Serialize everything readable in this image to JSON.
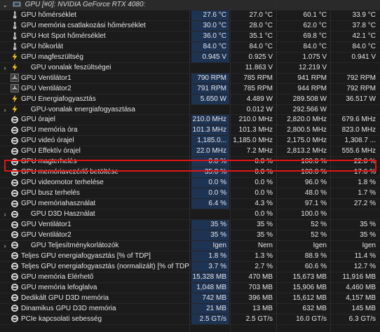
{
  "header": {
    "title": "GPU [#0]: NVIDIA GeForce RTX 4080:"
  },
  "rows": [
    {
      "icon": "thermometer-icon",
      "name": "GPU hőmérséklet",
      "v": [
        "27.6 °C",
        "27.0 °C",
        "60.1 °C",
        "33.9 °C"
      ]
    },
    {
      "icon": "thermometer-icon",
      "name": "GPU memória csatlakozási hőmérséklet",
      "v": [
        "30.0 °C",
        "28.0 °C",
        "62.0 °C",
        "37.8 °C"
      ]
    },
    {
      "icon": "thermometer-icon",
      "name": "GPU Hot Spot hőmérséklet",
      "v": [
        "36.0 °C",
        "35.1 °C",
        "69.8 °C",
        "42.1 °C"
      ]
    },
    {
      "icon": "thermometer-icon",
      "name": "GPU hőkorlát",
      "v": [
        "84.0 °C",
        "84.0 °C",
        "84.0 °C",
        "84.0 °C"
      ]
    },
    {
      "icon": "lightning-icon",
      "name": "GPU magfeszültség",
      "v": [
        "0.945 V",
        "0.925 V",
        "1.075 V",
        "0.941 V"
      ]
    },
    {
      "icon": "lightning-icon",
      "sub": true,
      "name": "GPU vonalak feszültségei",
      "v": [
        "",
        "11.863 V",
        "12.219 V",
        ""
      ]
    },
    {
      "icon": "fan-icon",
      "name": "GPU Ventilátor1",
      "v": [
        "790 RPM",
        "785 RPM",
        "941 RPM",
        "792 RPM"
      ]
    },
    {
      "icon": "fan-icon",
      "name": "GPU Ventilátor2",
      "v": [
        "791 RPM",
        "785 RPM",
        "944 RPM",
        "792 RPM"
      ]
    },
    {
      "icon": "lightning-icon",
      "name": "GPU Energiafogyasztás",
      "v": [
        "5.650 W",
        "4.489 W",
        "289.508 W",
        "36.517 W"
      ]
    },
    {
      "icon": "lightning-icon",
      "sub": true,
      "name": "GPU-vonalak energiafogyasztása",
      "v": [
        "",
        "0.012 W",
        "292.566 W",
        ""
      ]
    },
    {
      "icon": "gauge-icon",
      "name": "GPU órajel",
      "v": [
        "210.0 MHz",
        "210.0 MHz",
        "2,820.0 MHz",
        "679.6 MHz"
      ]
    },
    {
      "icon": "gauge-icon",
      "name": "GPU memória óra",
      "v": [
        "101.3 MHz",
        "101.3 MHz",
        "2,800.5 MHz",
        "823.0 MHz"
      ]
    },
    {
      "icon": "gauge-icon",
      "name": "GPU videó órajel",
      "v": [
        "1,185.0...",
        "1,185.0 MHz",
        "2,175.0 MHz",
        "1,308.7 ..."
      ]
    },
    {
      "icon": "gauge-icon",
      "name": "GPU Effektív órajel",
      "v": [
        "22.0 MHz",
        "7.2 MHz",
        "2,813.2 MHz",
        "555.6 MHz"
      ]
    },
    {
      "icon": "gauge-icon",
      "name": "GPU magterhelés",
      "v": [
        "0.0 %",
        "0.0 %",
        "100.0 %",
        "22.0 %"
      ]
    },
    {
      "icon": "gauge-icon",
      "name": "GPU memóriavezérlő betöltése",
      "v": [
        "35.0 %",
        "0.0 %",
        "100.0 %",
        "17.6 %"
      ]
    },
    {
      "icon": "gauge-icon",
      "name": "GPU videomotor terhelése",
      "v": [
        "0.0 %",
        "0.0 %",
        "96.0 %",
        "1.8 %"
      ]
    },
    {
      "icon": "gauge-icon",
      "name": "GPU busz terhelés",
      "v": [
        "0.0 %",
        "0.0 %",
        "48.0 %",
        "1.7 %"
      ]
    },
    {
      "icon": "gauge-icon",
      "name": "GPU memóriahasználat",
      "v": [
        "6.4 %",
        "4.3 %",
        "97.1 %",
        "27.2 %"
      ]
    },
    {
      "icon": "gauge-icon",
      "sub": true,
      "name": "GPU D3D Használat",
      "v": [
        "",
        "0.0 %",
        "100.0 %",
        ""
      ]
    },
    {
      "icon": "gauge-icon",
      "name": "GPU Ventilátor1",
      "v": [
        "35 %",
        "35 %",
        "52 %",
        "35 %"
      ]
    },
    {
      "icon": "gauge-icon",
      "name": "GPU Ventilátor2",
      "v": [
        "35 %",
        "35 %",
        "52 %",
        "35 %"
      ]
    },
    {
      "icon": "gauge-icon",
      "sub": true,
      "name": "GPU Teljesítménykorlátozók",
      "v": [
        "Igen",
        "Nem",
        "Igen",
        "Igen"
      ]
    },
    {
      "icon": "gauge-icon",
      "name": "Teljes GPU energiafogyasztás [% of TDP]",
      "v": [
        "1.8 %",
        "1.3 %",
        "88.9 %",
        "11.4 %"
      ]
    },
    {
      "icon": "gauge-icon",
      "name": "Teljes GPU energiafogyasztás (normalizált) [% of TDP]",
      "v": [
        "3.7 %",
        "2.7 %",
        "60.6 %",
        "12.7 %"
      ]
    },
    {
      "icon": "gauge-icon",
      "name": "GPU memória Elérhető",
      "v": [
        "15,328 MB",
        "470 MB",
        "15,673 MB",
        "11,916 MB"
      ]
    },
    {
      "icon": "gauge-icon",
      "name": "GPU memória lefoglalva",
      "v": [
        "1,048 MB",
        "703 MB",
        "15,906 MB",
        "4,460 MB"
      ]
    },
    {
      "icon": "gauge-icon",
      "name": "Dedikált GPU D3D memória",
      "v": [
        "742 MB",
        "396 MB",
        "15,612 MB",
        "4,157 MB"
      ]
    },
    {
      "icon": "gauge-icon",
      "name": "Dinamikus GPU D3D memória",
      "v": [
        "21 MB",
        "13 MB",
        "632 MB",
        "145 MB"
      ]
    },
    {
      "icon": "gauge-icon",
      "name": "PCIe kapcsolati sebesség",
      "v": [
        "2.5 GT/s",
        "2.5 GT/s",
        "16.0 GT/s",
        "6.3 GT/s"
      ]
    }
  ],
  "colors": {
    "current_cell_bg": "#1e3252",
    "highlight_border": "#e01414",
    "background": "#1b1b1b"
  }
}
